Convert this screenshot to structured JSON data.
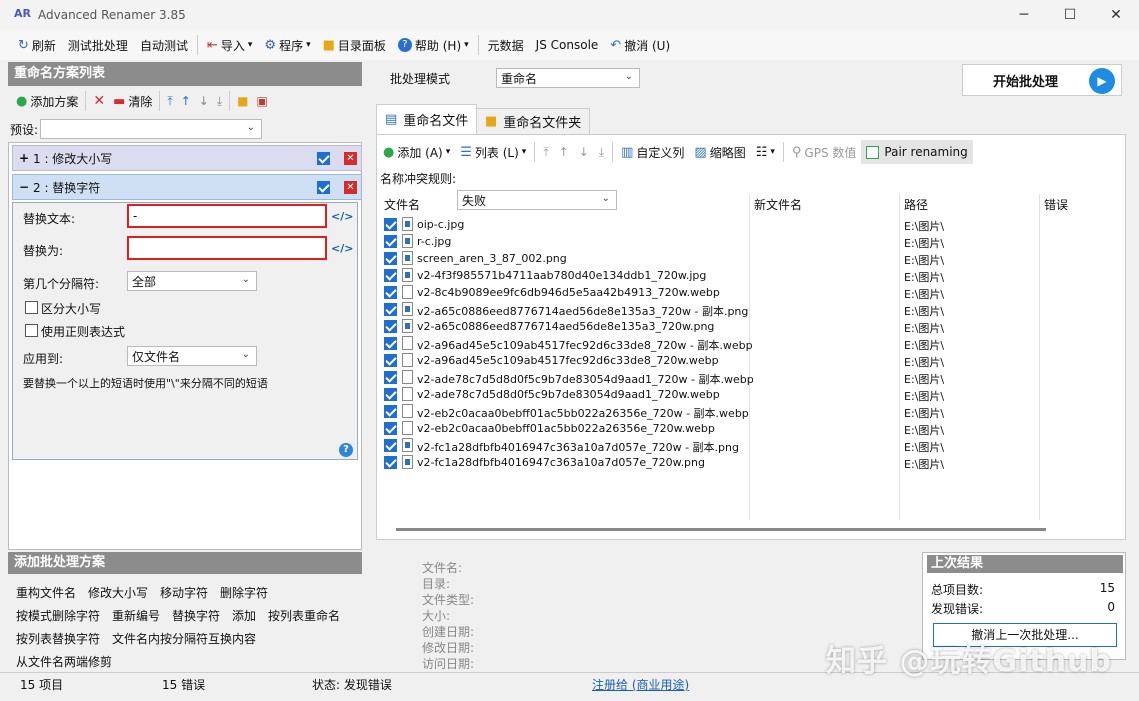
{
  "window": {
    "title": "Advanced Renamer 3.85",
    "logo": "AR",
    "minimize": "─",
    "maximize": "☐",
    "close": "✕"
  },
  "toolbar": [
    {
      "icon": "refresh-icon",
      "glyph": "↻",
      "label": "刷新"
    },
    {
      "label": "测试批处理"
    },
    {
      "label": "自动测试"
    },
    {
      "icon": "import-icon",
      "glyph": "⇤",
      "label": "导入",
      "dropdown": "▾"
    },
    {
      "icon": "program-icon",
      "glyph": "⚙",
      "label": "程序",
      "dropdown": "▾"
    },
    {
      "icon": "folder-icon",
      "glyph": "■",
      "label": "目录面板"
    },
    {
      "icon": "help-icon",
      "glyph": "?",
      "label": "帮助 (H)",
      "dropdown": "▾"
    },
    {
      "label": "元数据"
    },
    {
      "label": "JS Console"
    },
    {
      "icon": "undo-icon",
      "glyph": "↶",
      "label": "撤消 (U)"
    }
  ],
  "left": {
    "header": "重命名方案列表",
    "add": "添加方案",
    "clear": "清除",
    "preset_label": "预设:",
    "preset_value": "",
    "method1": "1 : 修改大小写",
    "method1_toggle": "+",
    "method2": "2 : 替换字符",
    "method2_toggle": "−",
    "replace_text_label": "替换文本:",
    "replace_text_value": "-",
    "replace_with_label": "替换为:",
    "replace_with_value": "",
    "code_tag": "</>",
    "nth_label": "第几个分隔符:",
    "nth_value": "全部",
    "case_label": "区分大小写",
    "regex_label": "使用正则表达式",
    "apply_label": "应用到:",
    "apply_value": "仅文件名",
    "hint": "要替换一个以上的短语时使用\"\\\"来分隔不同的短语"
  },
  "batch": {
    "header": "添加批处理方案",
    "items": [
      "重构文件名",
      "修改大小写",
      "移动字符",
      "删除字符",
      "按模式删除字符",
      "重新编号",
      "替换字符",
      "添加",
      "按列表重命名",
      "按列表替换字符",
      "文件名内按分隔符互换内容",
      "从文件名两端修剪"
    ]
  },
  "right": {
    "mode_label": "批处理模式",
    "mode_value": "重命名",
    "start": "开始批处理",
    "tab_files": "重命名文件",
    "tab_folders": "重命名文件夹",
    "add": "添加 (A)",
    "list": "列表 (L)",
    "custom_cols": "自定义列",
    "thumbs": "缩略图",
    "gps": "GPS 数值",
    "pair": "Pair renaming",
    "conflict_label": "名称冲突规则:",
    "conflict_value": "失败",
    "columns": [
      "文件名",
      "新文件名",
      "路径",
      "错误"
    ]
  },
  "files": [
    {
      "name": "oip-c.jpg",
      "path": "E:\\图片\\",
      "img": true
    },
    {
      "name": "r-c.jpg",
      "path": "E:\\图片\\",
      "img": true
    },
    {
      "name": "screen_aren_3_87_002.png",
      "path": "E:\\图片\\",
      "img": true
    },
    {
      "name": "v2-4f3f985571b4711aab780d40e134ddb1_720w.jpg",
      "path": "E:\\图片\\",
      "img": true
    },
    {
      "name": "v2-8c4b9089ee9fc6db946d5e5aa42b4913_720w.webp",
      "path": "E:\\图片\\",
      "img": false
    },
    {
      "name": "v2-a65c0886eed8776714aed56de8e135a3_720w - 副本.png",
      "path": "E:\\图片\\",
      "img": true
    },
    {
      "name": "v2-a65c0886eed8776714aed56de8e135a3_720w.png",
      "path": "E:\\图片\\",
      "img": true
    },
    {
      "name": "v2-a96ad45e5c109ab4517fec92d6c33de8_720w - 副本.webp",
      "path": "E:\\图片\\",
      "img": false
    },
    {
      "name": "v2-a96ad45e5c109ab4517fec92d6c33de8_720w.webp",
      "path": "E:\\图片\\",
      "img": false
    },
    {
      "name": "v2-ade78c7d5d8d0f5c9b7de83054d9aad1_720w - 副本.webp",
      "path": "E:\\图片\\",
      "img": false
    },
    {
      "name": "v2-ade78c7d5d8d0f5c9b7de83054d9aad1_720w.webp",
      "path": "E:\\图片\\",
      "img": false
    },
    {
      "name": "v2-eb2c0acaa0bebff01ac5bb022a26356e_720w - 副本.webp",
      "path": "E:\\图片\\",
      "img": false
    },
    {
      "name": "v2-eb2c0acaa0bebff01ac5bb022a26356e_720w.webp",
      "path": "E:\\图片\\",
      "img": false
    },
    {
      "name": "v2-fc1a28dfbfb4016947c363a10a7d057e_720w - 副本.png",
      "path": "E:\\图片\\",
      "img": true
    },
    {
      "name": "v2-fc1a28dfbfb4016947c363a10a7d057e_720w.png",
      "path": "E:\\图片\\",
      "img": true
    }
  ],
  "meta": [
    "文件名:",
    "目录:",
    "文件类型:",
    "大小:",
    "创建日期:",
    "修改日期:",
    "访问日期:"
  ],
  "last": {
    "header": "上次结果",
    "total_label": "总项目数:",
    "total": "15",
    "err_label": "发现错误:",
    "err": "0",
    "undo": "撤消上一次批处理..."
  },
  "status": {
    "items": "15 项目",
    "errors": "15 错误",
    "state": "状态: 发现错误",
    "reg": "注册给 (商业用途)"
  },
  "watermark": "知乎 @玩转Github"
}
